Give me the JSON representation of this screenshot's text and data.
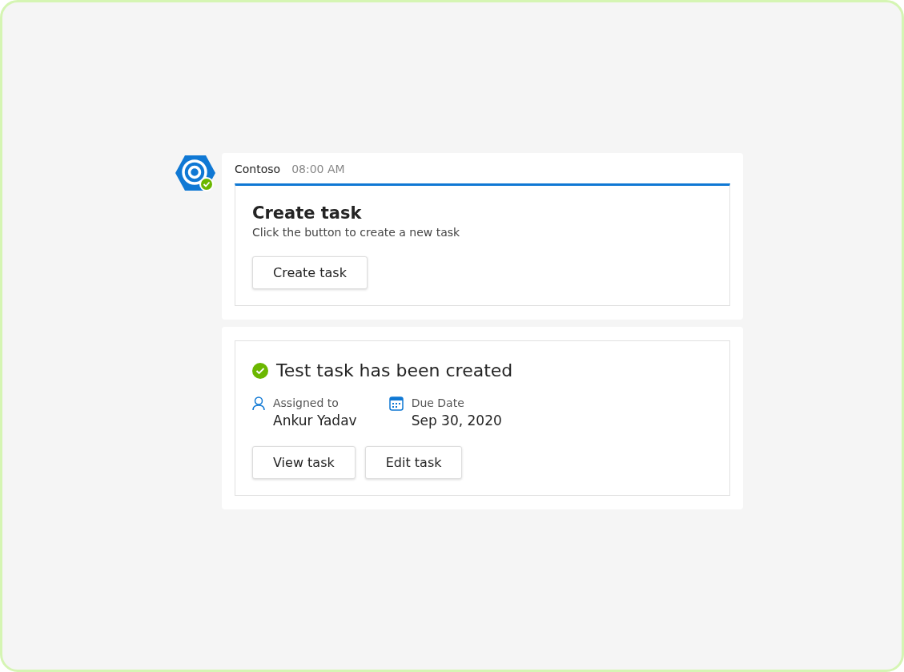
{
  "message": {
    "sender": "Contoso",
    "time": "08:00 AM"
  },
  "card": {
    "title": "Create task",
    "subtitle": "Click the button to create a new task",
    "button": "Create task"
  },
  "confirmation": {
    "title": "Test task has been created",
    "facts": [
      {
        "kind": "person",
        "label": "Assigned to",
        "value": "Ankur Yadav"
      },
      {
        "kind": "calendar",
        "label": "Due Date",
        "value": "Sep 30, 2020"
      }
    ],
    "buttons": [
      "View task",
      "Edit task"
    ]
  }
}
